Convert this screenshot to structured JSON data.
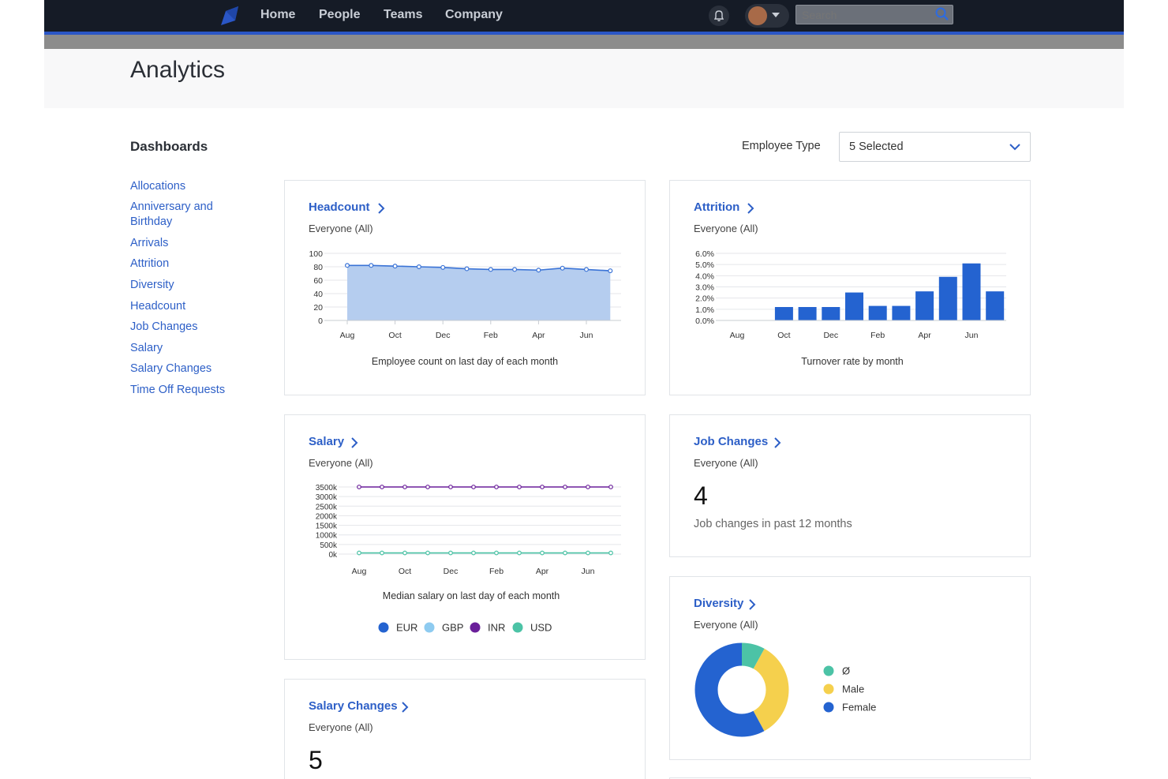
{
  "nav": {
    "links": [
      "Home",
      "People",
      "Teams",
      "Company"
    ],
    "search_placeholder": "Search"
  },
  "page": {
    "title": "Analytics"
  },
  "sidebar": {
    "title": "Dashboards",
    "items": [
      "Allocations",
      "Anniversary and Birthday",
      "Arrivals",
      "Attrition",
      "Diversity",
      "Headcount",
      "Job Changes",
      "Salary",
      "Salary Changes",
      "Time Off Requests"
    ]
  },
  "filter": {
    "label": "Employee Type",
    "value": "5 Selected"
  },
  "colors": {
    "accent": "#2d5fc7",
    "nav_bg": "#151b26",
    "area_fill": "#b5cdef",
    "bar": "#2463d0"
  },
  "cards": {
    "headcount": {
      "title": "Headcount",
      "subtitle": "Everyone (All)",
      "caption": "Employee count on last day of each month"
    },
    "attrition": {
      "title": "Attrition",
      "subtitle": "Everyone (All)",
      "caption": "Turnover rate by month"
    },
    "salary": {
      "title": "Salary",
      "subtitle": "Everyone (All)",
      "caption": "Median salary on last day of each month"
    },
    "job_changes": {
      "title": "Job Changes",
      "subtitle": "Everyone (All)",
      "value": "4",
      "description": "Job changes in past 12 months"
    },
    "diversity": {
      "title": "Diversity",
      "subtitle": "Everyone (All)"
    },
    "salary_changes": {
      "title": "Salary Changes",
      "subtitle": "Everyone (All)",
      "value": "5"
    }
  },
  "chart_data": [
    {
      "id": "headcount",
      "type": "area",
      "x": [
        "Aug",
        "Sep",
        "Oct",
        "Nov",
        "Dec",
        "Jan",
        "Feb",
        "Mar",
        "Apr",
        "May",
        "Jun",
        "Jul"
      ],
      "values": [
        82,
        82,
        81,
        80,
        79,
        77,
        76,
        76,
        75,
        78,
        76,
        74
      ],
      "x_ticks": [
        "Aug",
        "Oct",
        "Dec",
        "Feb",
        "Apr",
        "Jun"
      ],
      "y_ticks": [
        "0",
        "20",
        "40",
        "60",
        "80",
        "100"
      ],
      "ylim": [
        0,
        100
      ],
      "grid": true,
      "xlabel": "Employee count on last day of each month"
    },
    {
      "id": "attrition",
      "type": "bar",
      "categories": [
        "Aug",
        "Sep",
        "Oct",
        "Nov",
        "Dec",
        "Jan",
        "Feb",
        "Mar",
        "Apr",
        "May",
        "Jun",
        "Jul"
      ],
      "values": [
        0,
        0,
        1.2,
        1.2,
        1.2,
        2.5,
        1.3,
        1.3,
        2.6,
        3.9,
        5.1,
        2.6
      ],
      "x_ticks": [
        "Aug",
        "Oct",
        "Dec",
        "Feb",
        "Apr",
        "Jun"
      ],
      "y_ticks": [
        "0.0%",
        "1.0%",
        "2.0%",
        "3.0%",
        "4.0%",
        "5.0%",
        "6.0%"
      ],
      "ylim": [
        0,
        6
      ],
      "grid": true,
      "xlabel": "Turnover rate by month"
    },
    {
      "id": "salary",
      "type": "line",
      "x": [
        "Aug",
        "Sep",
        "Oct",
        "Nov",
        "Dec",
        "Jan",
        "Feb",
        "Mar",
        "Apr",
        "May",
        "Jun",
        "Jul"
      ],
      "series": [
        {
          "name": "EUR",
          "color": "#2463d0",
          "values": []
        },
        {
          "name": "GBP",
          "color": "#8ecbf0",
          "values": []
        },
        {
          "name": "INR",
          "color": "#6a1f9a",
          "values": [
            3500,
            3500,
            3500,
            3500,
            3500,
            3500,
            3500,
            3500,
            3500,
            3500,
            3500,
            3500
          ]
        },
        {
          "name": "USD",
          "color": "#4cc3a6",
          "values": [
            60,
            60,
            60,
            60,
            60,
            60,
            60,
            60,
            60,
            60,
            60,
            60
          ]
        }
      ],
      "x_ticks": [
        "Aug",
        "Oct",
        "Dec",
        "Feb",
        "Apr",
        "Jun"
      ],
      "y_ticks": [
        "0k",
        "500k",
        "1000k",
        "1500k",
        "2000k",
        "2500k",
        "3000k",
        "3500k"
      ],
      "ylim": [
        0,
        3500
      ],
      "grid": true,
      "xlabel": "Median salary on last day of each month",
      "legend": "bottom"
    },
    {
      "id": "diversity",
      "type": "pie",
      "donut": true,
      "slices": [
        {
          "label": "Ø",
          "value": 8,
          "color": "#4cc3a6"
        },
        {
          "label": "Male",
          "value": 34,
          "color": "#f5d04d"
        },
        {
          "label": "Female",
          "value": 58,
          "color": "#2463d0"
        }
      ],
      "legend": "right"
    }
  ]
}
